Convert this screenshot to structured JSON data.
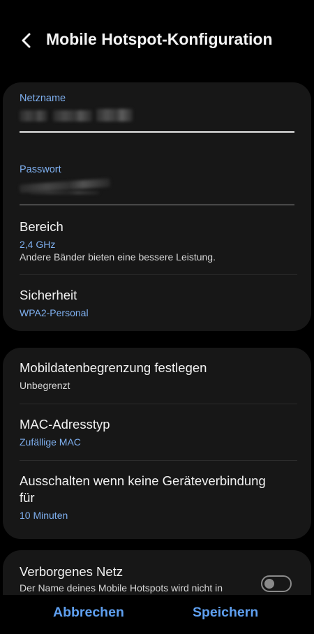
{
  "header": {
    "title": "Mobile Hotspot-Konfiguration"
  },
  "network": {
    "name_label": "Netzname",
    "password_label": "Passwort"
  },
  "band": {
    "title": "Bereich",
    "value": "2,4 GHz",
    "description": "Andere Bänder bieten eine bessere Leistung."
  },
  "security": {
    "title": "Sicherheit",
    "value": "WPA2-Personal"
  },
  "data_limit": {
    "title": "Mobildatenbegrenzung festlegen",
    "value": "Unbegrenzt"
  },
  "mac": {
    "title": "MAC-Adresstyp",
    "value": "Zufällige MAC"
  },
  "timeout": {
    "title_line1": "Ausschalten wenn keine Geräteverbindung",
    "title_line2": "für",
    "value": "10 Minuten"
  },
  "hidden_network": {
    "title": "Verborgenes Netz",
    "description": "Der Name deines Mobile Hotspots wird nicht in",
    "enabled": false
  },
  "footer": {
    "cancel_label": "Abbrechen",
    "save_label": "Speichern"
  },
  "colors": {
    "accent": "#5fa0f0",
    "label_blue": "#7fb0f0",
    "card_bg": "#171717",
    "background": "#000000"
  }
}
